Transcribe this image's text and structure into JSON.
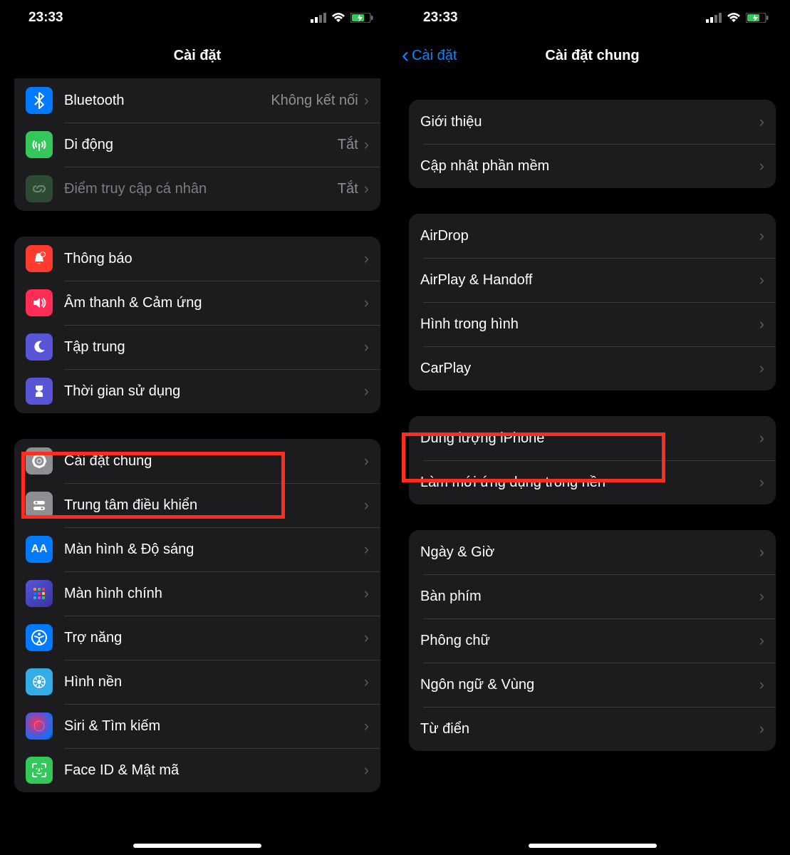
{
  "status": {
    "time": "23:33"
  },
  "left": {
    "title": "Cài đặt",
    "group1": [
      {
        "label": "Bluetooth",
        "value": "Không kết nối",
        "icon": "bluetooth",
        "color": "ic-blue"
      },
      {
        "label": "Di động",
        "value": "Tắt",
        "icon": "antenna",
        "color": "ic-green"
      },
      {
        "label": "Điểm truy cập cá nhân",
        "value": "Tắt",
        "icon": "link",
        "color": "ic-darkgreen",
        "dim": true
      }
    ],
    "group2": [
      {
        "label": "Thông báo",
        "icon": "bell",
        "color": "ic-red"
      },
      {
        "label": "Âm thanh & Cảm ứng",
        "icon": "speaker",
        "color": "ic-pink"
      },
      {
        "label": "Tập trung",
        "icon": "moon",
        "color": "ic-indigo"
      },
      {
        "label": "Thời gian sử dụng",
        "icon": "hourglass",
        "color": "ic-indigo"
      }
    ],
    "group3": [
      {
        "label": "Cài đặt chung",
        "icon": "gear",
        "color": "ic-gray"
      },
      {
        "label": "Trung tâm điều khiển",
        "icon": "switches",
        "color": "ic-gray"
      },
      {
        "label": "Màn hình & Độ sáng",
        "icon": "aa",
        "color": "ic-blue"
      },
      {
        "label": "Màn hình chính",
        "icon": "grid",
        "color": "ic-indigo"
      },
      {
        "label": "Trợ năng",
        "icon": "accessibility",
        "color": "ic-blue"
      },
      {
        "label": "Hình nền",
        "icon": "wallpaper",
        "color": "ic-cyan"
      },
      {
        "label": "Siri & Tìm kiếm",
        "icon": "siri",
        "color": "ic-black"
      },
      {
        "label": "Face ID & Mật mã",
        "icon": "faceid",
        "color": "ic-green"
      }
    ]
  },
  "right": {
    "back": "Cài đặt",
    "title": "Cài đặt chung",
    "group1": [
      {
        "label": "Giới thiệu"
      },
      {
        "label": "Cập nhật phần mềm"
      }
    ],
    "group2": [
      {
        "label": "AirDrop"
      },
      {
        "label": "AirPlay & Handoff"
      },
      {
        "label": "Hình trong hình"
      },
      {
        "label": "CarPlay"
      }
    ],
    "group3": [
      {
        "label": "Dung lượng iPhone"
      },
      {
        "label": "Làm mới ứng dụng trong nền"
      }
    ],
    "group4": [
      {
        "label": "Ngày & Giờ"
      },
      {
        "label": "Bàn phím"
      },
      {
        "label": "Phông chữ"
      },
      {
        "label": "Ngôn ngữ & Vùng"
      },
      {
        "label": "Từ điển"
      }
    ]
  }
}
